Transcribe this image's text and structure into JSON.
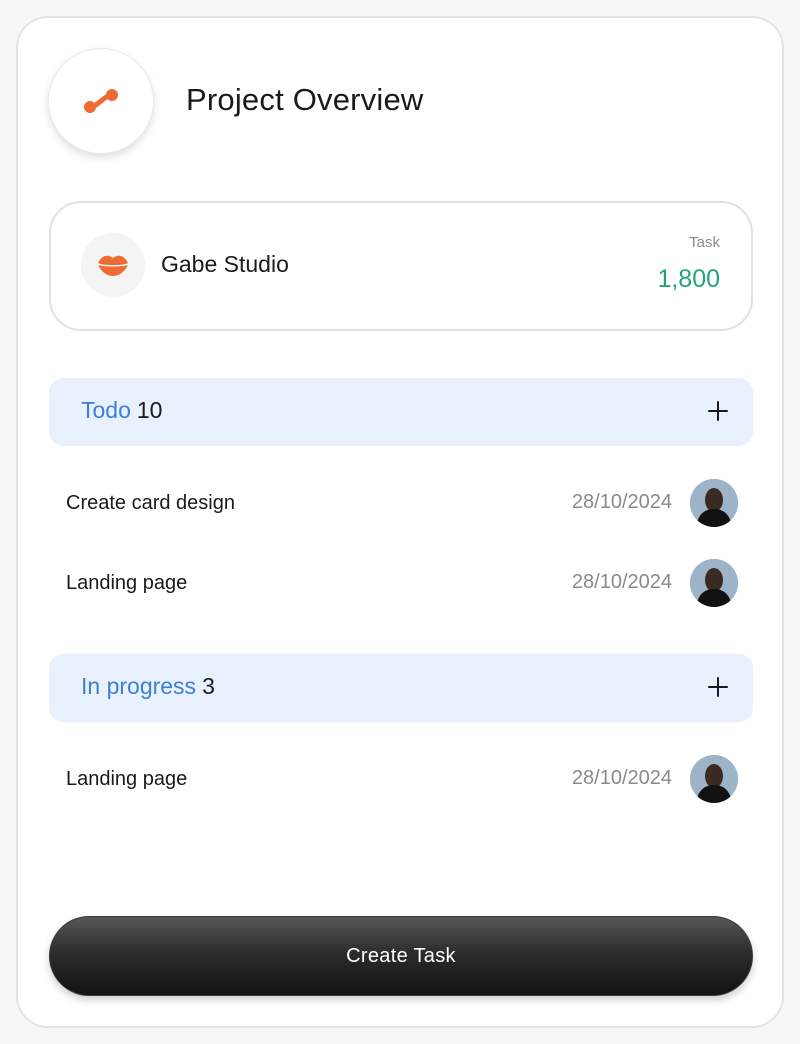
{
  "header": {
    "title": "Project Overview",
    "logo_icon": "connection-nodes-icon",
    "logo_color": "#ef6b33"
  },
  "client": {
    "name": "Gabe Studio",
    "icon": "lips-logo-icon",
    "task_label": "Task",
    "task_count": "1,800",
    "task_count_color": "#22a37a"
  },
  "sections": [
    {
      "label": "Todo",
      "count": "10",
      "tasks": [
        {
          "name": "Create card design",
          "date": "28/10/2024"
        },
        {
          "name": "Landing page",
          "date": "28/10/2024"
        }
      ]
    },
    {
      "label": "In progress",
      "count": "3",
      "tasks": [
        {
          "name": "Landing page",
          "date": "28/10/2024"
        }
      ]
    }
  ],
  "footer": {
    "create_label": "Create Task"
  },
  "colors": {
    "accent_blue": "#3d7fd6",
    "section_bg": "#e9f1fe",
    "brand_orange": "#ef6b33"
  }
}
